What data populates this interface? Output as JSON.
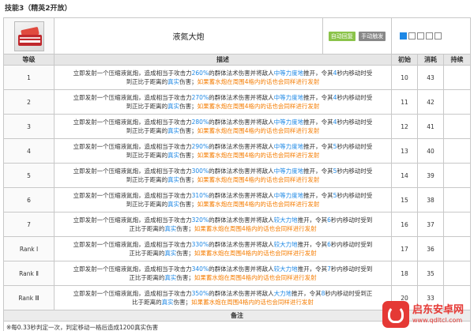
{
  "page_title": "技能3（精英2开放）",
  "skill": {
    "name": "液氮大炮",
    "tags": [
      "自动回复",
      "手动触发"
    ],
    "sp_boxes": [
      true,
      false,
      false,
      false,
      false
    ]
  },
  "columns": {
    "level": "等级",
    "description": "描述",
    "initial": "初始",
    "cost": "消耗",
    "duration": "持续"
  },
  "rows": [
    {
      "level": "1",
      "a": "立即发射一个压缩液氮炮，造成相当于攻击力",
      "pct": "260%",
      "b": "的群体法术伤害并将敌人",
      "force": "中等力度地",
      "c": "推开，令其",
      "secs": "4",
      "d": "秒内移动时受",
      "e": "到正比于距离的",
      "real": "真实",
      "f": "伤害；",
      "g": "如果蓄水炮在周围4格内的话也会同样进行发射",
      "initial": "10",
      "cost": "43",
      "duration": ""
    },
    {
      "level": "2",
      "a": "立即发射一个压缩液氮炮，造成相当于攻击力",
      "pct": "270%",
      "b": "的群体法术伤害并将敌人",
      "force": "中等力度地",
      "c": "推开，令其",
      "secs": "4",
      "d": "秒内移动时受",
      "e": "到正比于距离的",
      "real": "真实",
      "f": "伤害；",
      "g": "如果蓄水炮在周围4格内的话也会同样进行发射",
      "initial": "11",
      "cost": "42",
      "duration": ""
    },
    {
      "level": "3",
      "a": "立即发射一个压缩液氮炮，造成相当于攻击力",
      "pct": "280%",
      "b": "的群体法术伤害并将敌人",
      "force": "中等力度地",
      "c": "推开，令其",
      "secs": "4",
      "d": "秒内移动时受",
      "e": "到正比于距离的",
      "real": "真实",
      "f": "伤害；",
      "g": "如果蓄水炮在周围4格内的话也会同样进行发射",
      "initial": "12",
      "cost": "41",
      "duration": ""
    },
    {
      "level": "4",
      "a": "立即发射一个压缩液氮炮，造成相当于攻击力",
      "pct": "290%",
      "b": "的群体法术伤害并将敌人",
      "force": "中等力度地",
      "c": "推开，令其",
      "secs": "5",
      "d": "秒内移动时受",
      "e": "到正比于距离的",
      "real": "真实",
      "f": "伤害；",
      "g": "如果蓄水炮在周围4格内的话也会同样进行发射",
      "initial": "13",
      "cost": "40",
      "duration": ""
    },
    {
      "level": "5",
      "a": "立即发射一个压缩液氮炮，造成相当于攻击力",
      "pct": "300%",
      "b": "的群体法术伤害并将敌人",
      "force": "中等力度地",
      "c": "推开，令其",
      "secs": "5",
      "d": "秒内移动时受",
      "e": "到正比于距离的",
      "real": "真实",
      "f": "伤害；",
      "g": "如果蓄水炮在周围4格内的话也会同样进行发射",
      "initial": "14",
      "cost": "39",
      "duration": ""
    },
    {
      "level": "6",
      "a": "立即发射一个压缩液氮炮，造成相当于攻击力",
      "pct": "310%",
      "b": "的群体法术伤害并将敌人",
      "force": "中等力度地",
      "c": "推开，令其",
      "secs": "5",
      "d": "秒内移动时受",
      "e": "到正比于距离的",
      "real": "真实",
      "f": "伤害；",
      "g": "如果蓄水炮在周围4格内的话也会同样进行发射",
      "initial": "15",
      "cost": "38",
      "duration": ""
    },
    {
      "level": "7",
      "a": "立即发射一个压缩液氮炮，造成相当于攻击力",
      "pct": "320%",
      "b": "的群体法术伤害并将敌人",
      "force": "较大力地",
      "c": "推开，令其",
      "secs": "6",
      "d": "秒内移动时受到",
      "e": "正比于距离的",
      "real": "真实",
      "f": "伤害；",
      "g": "如果蓄水炮在周围4格内的话也会同样进行发射",
      "initial": "16",
      "cost": "37",
      "duration": ""
    },
    {
      "level": "Rank Ⅰ",
      "a": "立即发射一个压缩液氮炮，造成相当于攻击力",
      "pct": "330%",
      "b": "的群体法术伤害并将敌人",
      "force": "较大力地",
      "c": "推开，令其",
      "secs": "6",
      "d": "秒内移动时受到",
      "e": "正比于距离的",
      "real": "真实",
      "f": "伤害；",
      "g": "如果蓄水炮在周围4格内的话也会同样进行发射",
      "initial": "17",
      "cost": "36",
      "duration": ""
    },
    {
      "level": "Rank Ⅱ",
      "a": "立即发射一个压缩液氮炮，造成相当于攻击力",
      "pct": "340%",
      "b": "的群体法术伤害并将敌人",
      "force": "较大力地",
      "c": "推开，令其",
      "secs": "7",
      "d": "秒内移动时受到",
      "e": "正比于距离的",
      "real": "真实",
      "f": "伤害；",
      "g": "如果蓄水炮在周围4格内的话也会同样进行发射",
      "initial": "18",
      "cost": "35",
      "duration": ""
    },
    {
      "level": "Rank Ⅲ",
      "a": "立即发射一个压缩液氮炮，造成相当于攻击力",
      "pct": "350%",
      "b": "的群体法术伤害并将敌人",
      "force": "大力地",
      "c": "推开，令其",
      "secs": "8",
      "d": "秒内移动时受到正",
      "e": "比于距离的",
      "real": "真实",
      "f": "伤害；",
      "g": "如果蓄水炮在周围4格内的话也会同样进行发射",
      "initial": "20",
      "cost": "33",
      "duration": ""
    }
  ],
  "notes": {
    "header": "备注",
    "text": "※每0.33秒判定一次，判定移动一格后造成1200真实伤害"
  },
  "watermark": {
    "name": "启东安卓网",
    "url": "www.qdltcl.com"
  },
  "colors": {
    "highlight_blue": "#1e88e5",
    "highlight_orange": "#f57c00",
    "tag_auto": "#8bc34a",
    "tag_manual": "#888888"
  }
}
